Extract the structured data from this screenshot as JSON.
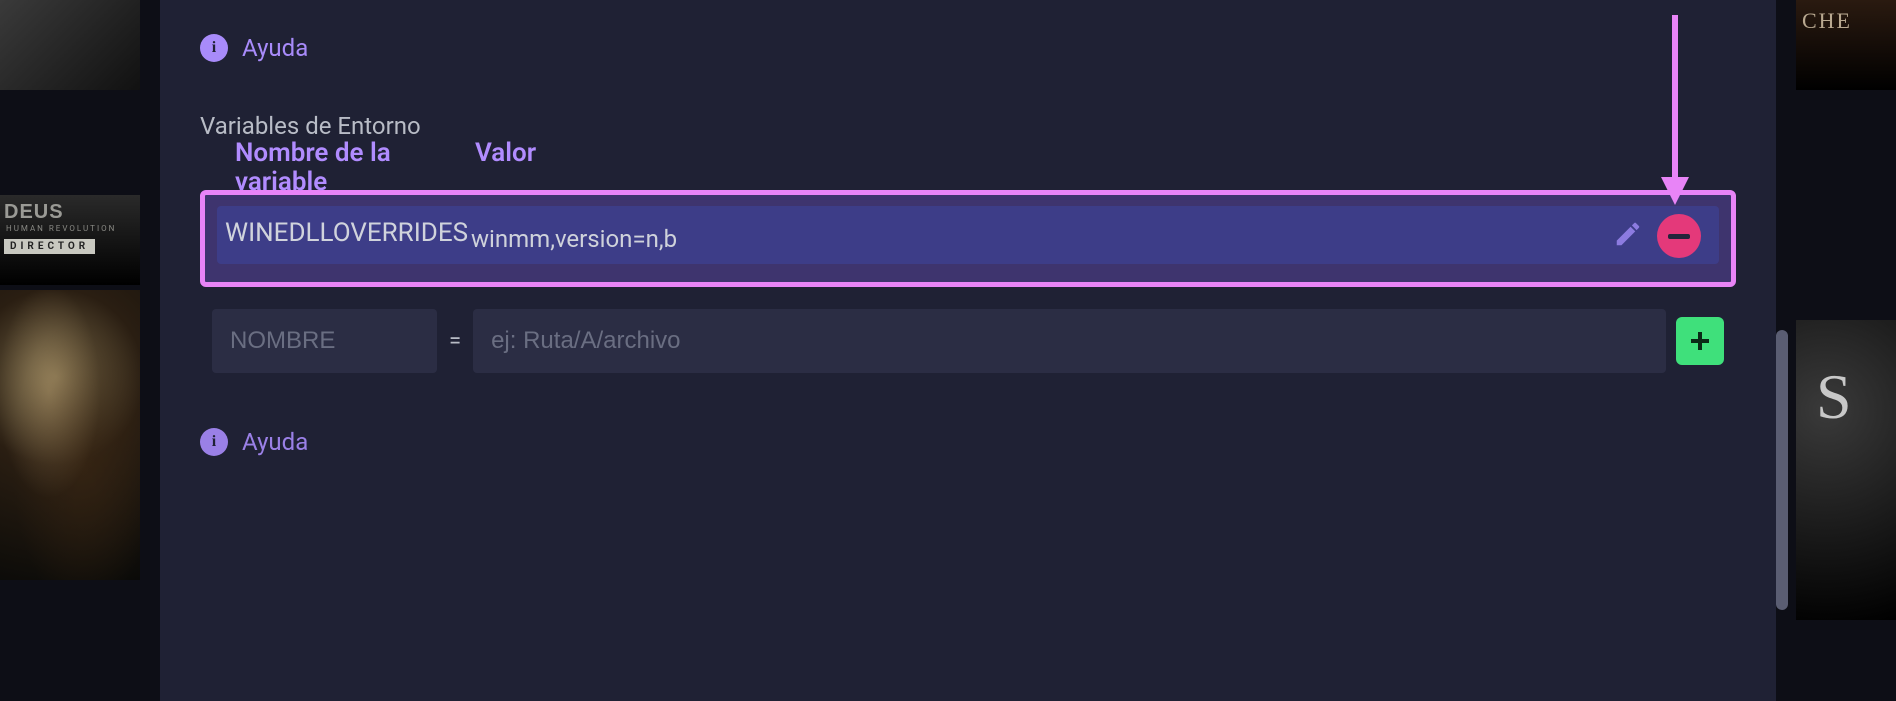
{
  "help": {
    "top_label": "Ayuda",
    "bottom_label": "Ayuda"
  },
  "section": {
    "title": "Variables de Entorno"
  },
  "headers": {
    "name": "Nombre de la variable",
    "value": "Valor"
  },
  "env_vars": [
    {
      "name": "WINEDLLOVERRIDES",
      "value": "winmm,version=n,b"
    }
  ],
  "new_var": {
    "name_value": "",
    "name_placeholder": "NOMBRE",
    "equals": "=",
    "value_value": "",
    "value_placeholder": "ej: Ruta/A/archivo"
  },
  "left_thumbs": {
    "deus_title": "DEUS",
    "deus_sub": "HUMAN REVOLUTION",
    "deus_tag": "DIRECTOR"
  },
  "right_thumbs": {
    "r1_text": "CHE",
    "r2_text": "S"
  },
  "colors": {
    "accent": "#a88bfa",
    "annotation": "#e884f7",
    "danger": "#e4397a",
    "success": "#3fe07b",
    "panel": "#1f2134",
    "row": "#3d3d88",
    "input": "#2b2d44"
  }
}
